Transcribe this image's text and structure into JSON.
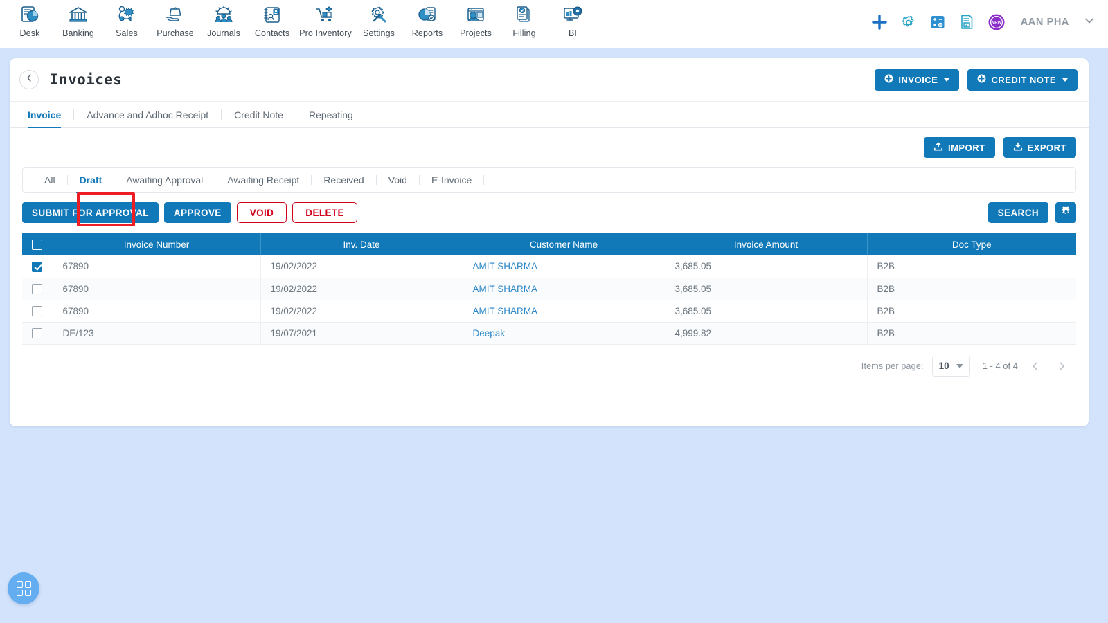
{
  "topnav": {
    "items": [
      {
        "label": "Desk",
        "icon": "dashboard-icon"
      },
      {
        "label": "Banking",
        "icon": "bank-icon"
      },
      {
        "label": "Sales",
        "icon": "sales-icon"
      },
      {
        "label": "Purchase",
        "icon": "purchase-icon"
      },
      {
        "label": "Journals",
        "icon": "journals-icon"
      },
      {
        "label": "Contacts",
        "icon": "contacts-icon"
      },
      {
        "label": "Pro Inventory",
        "icon": "inventory-icon"
      },
      {
        "label": "Settings",
        "icon": "settings-tools-icon"
      },
      {
        "label": "Reports",
        "icon": "reports-icon"
      },
      {
        "label": "Projects",
        "icon": "projects-icon"
      },
      {
        "label": "Filling",
        "icon": "filling-icon"
      },
      {
        "label": "BI",
        "icon": "bi-icon"
      }
    ],
    "right_icons": [
      {
        "name": "add-plus-icon",
        "color": "#1a6fc4"
      },
      {
        "name": "gear-icon",
        "color": "#27a3c4"
      },
      {
        "name": "calculator-icon",
        "color": "#2e8fd0"
      },
      {
        "name": "note-icon",
        "color": "#27a3c4"
      },
      {
        "name": "new-badge-icon",
        "color": "#8b2fc9",
        "text": "NEW"
      }
    ],
    "user": "AAN PHA"
  },
  "page": {
    "title": "Invoices",
    "back_icon": "chevron-left-icon",
    "primary_actions": [
      {
        "label": "INVOICE",
        "icon": "plus-circle-icon",
        "caret": true
      },
      {
        "label": "CREDIT NOTE",
        "icon": "plus-circle-icon",
        "caret": true
      }
    ],
    "tabs": [
      {
        "label": "Invoice",
        "active": true
      },
      {
        "label": "Advance and Adhoc Receipt",
        "active": false
      },
      {
        "label": "Credit Note",
        "active": false
      },
      {
        "label": "Repeating",
        "active": false
      }
    ],
    "io_buttons": [
      {
        "label": "IMPORT",
        "icon": "upload-icon"
      },
      {
        "label": "EXPORT",
        "icon": "download-icon"
      }
    ],
    "filters": [
      {
        "label": "All",
        "active": false
      },
      {
        "label": "Draft",
        "active": true
      },
      {
        "label": "Awaiting Approval",
        "active": false
      },
      {
        "label": "Awaiting Receipt",
        "active": false
      },
      {
        "label": "Received",
        "active": false
      },
      {
        "label": "Void",
        "active": false
      },
      {
        "label": "E-Invoice",
        "active": false
      }
    ],
    "actions": {
      "submit_for_approval": "SUBMIT FOR APPROVAL",
      "approve": "APPROVE",
      "void": "VOID",
      "delete": "DELETE",
      "search": "SEARCH",
      "settings_icon": "gear-icon",
      "highlight_target": "VOID",
      "highlight_color": "#ee1c25"
    }
  },
  "table": {
    "columns": [
      "Invoice Number",
      "Inv. Date",
      "Customer Name",
      "Invoice Amount",
      "Doc Type"
    ],
    "select_all_checked": false,
    "rows": [
      {
        "checked": true,
        "invoice_number": "67890",
        "inv_date": "19/02/2022",
        "customer_name": "AMIT SHARMA",
        "invoice_amount": "3,685.05",
        "doc_type": "B2B"
      },
      {
        "checked": false,
        "invoice_number": "67890",
        "inv_date": "19/02/2022",
        "customer_name": "AMIT SHARMA",
        "invoice_amount": "3,685.05",
        "doc_type": "B2B"
      },
      {
        "checked": false,
        "invoice_number": "67890",
        "inv_date": "19/02/2022",
        "customer_name": "AMIT SHARMA",
        "invoice_amount": "3,685.05",
        "doc_type": "B2B"
      },
      {
        "checked": false,
        "invoice_number": "DE/123",
        "inv_date": "19/07/2021",
        "customer_name": "Deepak",
        "invoice_amount": "4,999.82",
        "doc_type": "B2B"
      }
    ]
  },
  "paginator": {
    "items_per_page_label": "Items per page:",
    "items_per_page_value": "10",
    "range": "1 - 4 of 4",
    "prev_icon": "chevron-left-icon",
    "next_icon": "chevron-right-icon"
  },
  "fab": {
    "icon": "apps-grid-icon"
  },
  "colors": {
    "brand_blue": "#1279b8",
    "danger_red": "#d0021b",
    "highlight_red": "#ee1c25",
    "page_background": "#d3e3fb",
    "link_blue": "#2b87c7"
  }
}
